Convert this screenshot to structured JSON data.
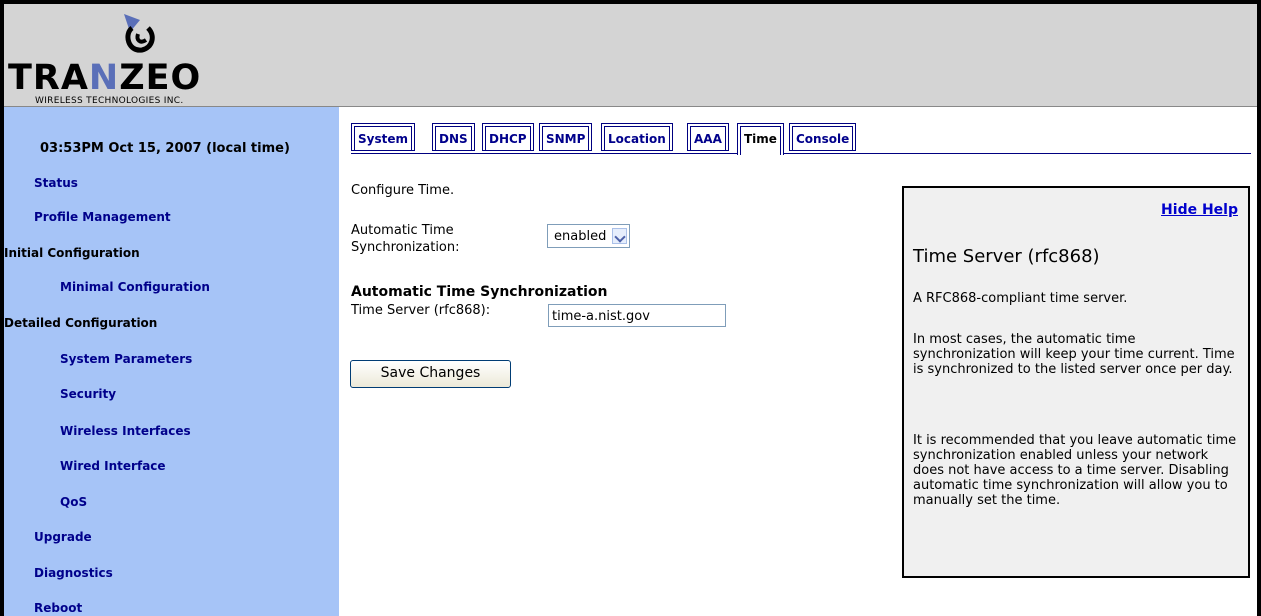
{
  "brand": {
    "name_a": "TRA",
    "name_n": "N",
    "name_b": "ZEO",
    "tagline": "WIRELESS TECHNOLOGIES INC."
  },
  "clock": "03:53PM Oct 15, 2007 (local time)",
  "nav": {
    "status": "Status",
    "profile": "Profile Management",
    "initial": "Initial Configuration",
    "minimal": "Minimal Configuration",
    "detailed": "Detailed Configuration",
    "system_params": "System Parameters",
    "security": "Security",
    "wireless": "Wireless Interfaces",
    "wired": "Wired Interface",
    "qos": "QoS",
    "upgrade": "Upgrade",
    "diagnostics": "Diagnostics",
    "reboot": "Reboot"
  },
  "tabs": [
    "System",
    "DNS",
    "DHCP",
    "SNMP",
    "Location",
    "AAA",
    "Time",
    "Console"
  ],
  "active_tab": "Time",
  "form": {
    "intro": "Configure Time.",
    "auto_label_1": "Automatic Time",
    "auto_label_2": "Synchronization:",
    "auto_value": "enabled",
    "section_heading": "Automatic Time Synchronization",
    "server_label": "Time Server (rfc868):",
    "server_value": "time-a.nist.gov",
    "save_label": "Save Changes"
  },
  "help": {
    "hide_label": "Hide Help",
    "title": "Time Server (rfc868)",
    "p1": "A RFC868-compliant time server.",
    "p2": "In most cases, the automatic time synchronization will keep your time current. Time is synchronized to the listed server once per day.",
    "p3": "It is recommended that you leave automatic time synchronization enabled unless your network does not have access to a time server. Disabling automatic time synchronization will allow you to manually set the time."
  },
  "colors": {
    "sidebar": "#a6c4f7",
    "link": "#00008b",
    "header": "#d4d4d4"
  }
}
